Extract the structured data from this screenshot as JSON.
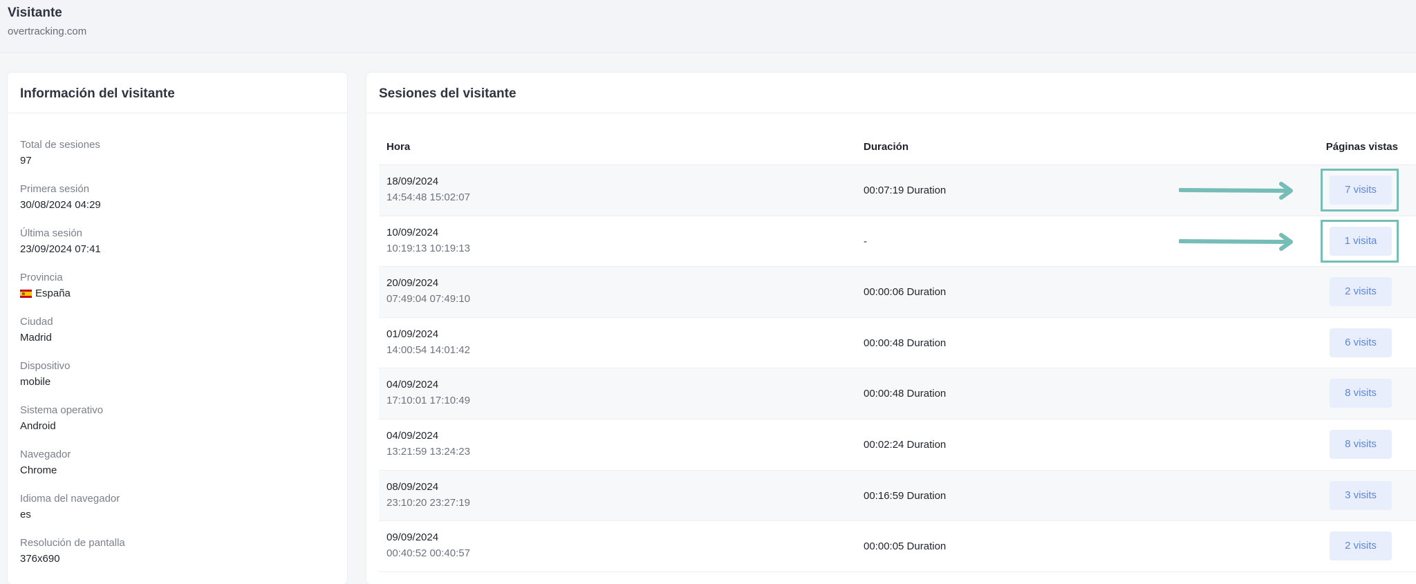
{
  "header": {
    "title": "Visitante",
    "subtitle": "overtracking.com"
  },
  "visitor_info": {
    "title": "Información del visitante",
    "fields": [
      {
        "label": "Total de sesiones",
        "value": "97"
      },
      {
        "label": "Primera sesión",
        "value": "30/08/2024 04:29"
      },
      {
        "label": "Última sesión",
        "value": "23/09/2024 07:41"
      },
      {
        "label": "Provincia",
        "value": "España",
        "icon": "spain-flag-icon"
      },
      {
        "label": "Ciudad",
        "value": "Madrid"
      },
      {
        "label": "Dispositivo",
        "value": "mobile"
      },
      {
        "label": "Sistema operativo",
        "value": "Android"
      },
      {
        "label": "Navegador",
        "value": "Chrome"
      },
      {
        "label": "Idioma del navegador",
        "value": "es"
      },
      {
        "label": "Resolución de pantalla",
        "value": "376x690"
      }
    ]
  },
  "sessions": {
    "title": "Sesiones del visitante",
    "columns": {
      "hora": "Hora",
      "duracion": "Duración",
      "paginas": "Páginas vistas"
    },
    "rows": [
      {
        "date": "18/09/2024",
        "times": "14:54:48 15:02:07",
        "duration": "00:07:19 Duration",
        "visits": "7 visits",
        "highlighted": true
      },
      {
        "date": "10/09/2024",
        "times": "10:19:13 10:19:13",
        "duration": "-",
        "visits": "1 visita",
        "highlighted": true
      },
      {
        "date": "20/09/2024",
        "times": "07:49:04 07:49:10",
        "duration": "00:00:06 Duration",
        "visits": "2 visits",
        "highlighted": false
      },
      {
        "date": "01/09/2024",
        "times": "14:00:54 14:01:42",
        "duration": "00:00:48 Duration",
        "visits": "6 visits",
        "highlighted": false
      },
      {
        "date": "04/09/2024",
        "times": "17:10:01 17:10:49",
        "duration": "00:00:48 Duration",
        "visits": "8 visits",
        "highlighted": false
      },
      {
        "date": "04/09/2024",
        "times": "13:21:59 13:24:23",
        "duration": "00:02:24 Duration",
        "visits": "8 visits",
        "highlighted": false
      },
      {
        "date": "08/09/2024",
        "times": "23:10:20 23:27:19",
        "duration": "00:16:59 Duration",
        "visits": "3 visits",
        "highlighted": false
      },
      {
        "date": "09/09/2024",
        "times": "00:40:52 00:40:57",
        "duration": "00:00:05 Duration",
        "visits": "2 visits",
        "highlighted": false
      }
    ]
  },
  "colors": {
    "accent": "#5e86d9",
    "button_bg": "#e8eefb",
    "highlight": "#76bdb8"
  }
}
